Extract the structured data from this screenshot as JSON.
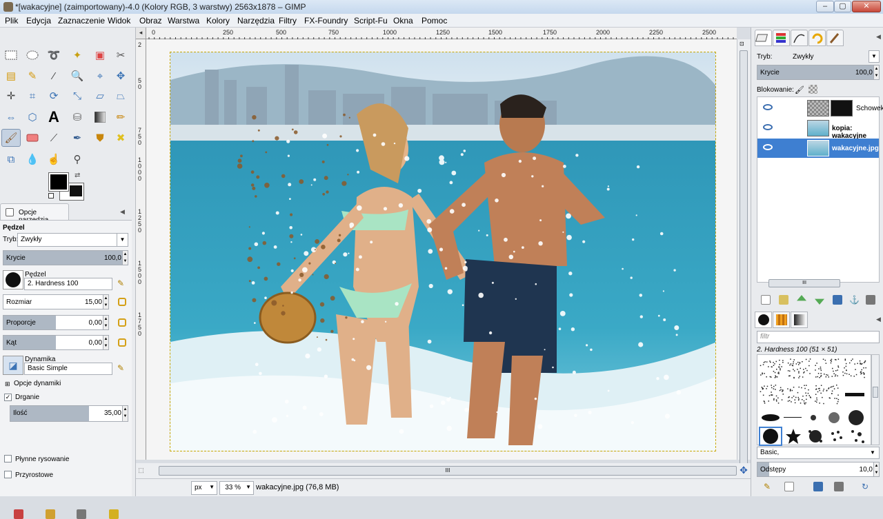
{
  "window": {
    "title": "*[wakacyjne] (zaimportowany)-4.0 (Kolory RGB, 3 warstwy) 2563x1878 – GIMP"
  },
  "menu": [
    "Plik",
    "Edycja",
    "Zaznaczenie",
    "Widok",
    "Obraz",
    "Warstwa",
    "Kolory",
    "Narzędzia",
    "Filtry",
    "FX-Foundry",
    "Script-Fu",
    "Okna",
    "Pomoc"
  ],
  "ruler": {
    "h": [
      "0",
      "250",
      "500",
      "750",
      "1000",
      "1250",
      "1500",
      "1750",
      "2000",
      "2250",
      "2500"
    ],
    "v": [
      "2",
      "5",
      "0",
      "7",
      "5",
      "0",
      "1",
      "0",
      "0",
      "0",
      "1",
      "2",
      "5",
      "0",
      "1",
      "5",
      "0",
      "0",
      "1",
      "7",
      "5",
      "0"
    ]
  },
  "tool_options": {
    "tab": "Opcje narzędzia",
    "title": "Pędzel",
    "mode_label": "Tryb:",
    "mode_value": "Zwykły",
    "opacity_label": "Krycie",
    "opacity_value": "100,0",
    "opacity_fraction": 1.0,
    "brush_label": "Pędzel",
    "brush_value": "2. Hardness 100",
    "size_label": "Rozmiar",
    "size_value": "15,00",
    "ratio_label": "Proporcje",
    "ratio_value": "0,00",
    "angle_label": "Kąt",
    "angle_value": "0,00",
    "dynamics_label": "Dynamika",
    "dynamics_value": "Basic Simple",
    "dynamics_options": "Opcje dynamiki",
    "jitter_label": "Drganie",
    "amount_label": "Ilość",
    "amount_value": "35,00",
    "smooth_label": "Płynne rysowanie",
    "incremental_label": "Przyrostowe"
  },
  "status": {
    "unit": "px",
    "zoom": "33 %",
    "info": "wakacyjne.jpg (76,8 MB)"
  },
  "layers": {
    "mode_label": "Tryb:",
    "mode_value": "Zwykły",
    "opacity_label": "Krycie",
    "opacity_value": "100,0",
    "lock_label": "Blokowanie:",
    "items": [
      {
        "name": "Schowek",
        "bold": false
      },
      {
        "name": "kopia: wakacyjne",
        "bold": true
      },
      {
        "name": "wakacyjne.jpg",
        "bold": true
      }
    ]
  },
  "brushes": {
    "filter_placeholder": "filtr",
    "selected": "2. Hardness 100 (51 × 51)",
    "tag": "Basic,",
    "spacing_label": "Odstępy",
    "spacing_value": "10,0"
  },
  "colors": {
    "accent": "#3e7fd1",
    "selection": "#3e7fd1"
  }
}
